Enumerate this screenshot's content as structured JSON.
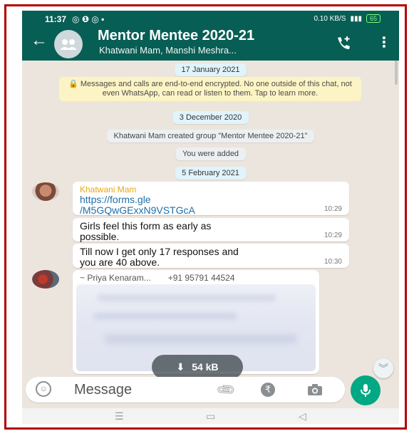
{
  "status_bar": {
    "time": "11:37",
    "net_speed": "0.10 KB/S",
    "battery": "65"
  },
  "header": {
    "title": "Mentor Mentee 2020-21",
    "subtitle": "Khatwani Mam, Manshi Meshra..."
  },
  "chat": {
    "date_1": "17 January 2021",
    "encryption_notice": "🔒 Messages and calls are end-to-end encrypted. No one outside of this chat, not even WhatsApp, can read or listen to them. Tap to learn more.",
    "date_2": "3 December 2020",
    "system_created": "Khatwani Mam created group \"Mentor Mentee 2020-21\"",
    "system_added": "You were added",
    "date_3": "5 February 2021",
    "messages": [
      {
        "sender": "Khatwani Mam",
        "text_line1": "https://forms.gle",
        "text_line2": "/M5GQwGExxN9VSTGcA",
        "time": "10:29"
      },
      {
        "text_line1": "Girls feel this form as early as",
        "text_line2": "possible.",
        "time": "10:29"
      },
      {
        "text_line1": "Till now I get only 17 responses and",
        "text_line2": "you are 40 above.",
        "time": "10:30"
      }
    ],
    "media": {
      "sender_name": "~ Priya Kenaram...",
      "sender_phone": "+91 95791 44524",
      "download_size": "54 kB"
    }
  },
  "input": {
    "placeholder": "Message"
  },
  "colors": {
    "header": "#075e54",
    "chat_bg": "#ece5dd",
    "sender_name": "#e6a817",
    "mic_button": "#00a884"
  },
  "icons": [
    "back-arrow-icon",
    "group-avatar-icon",
    "add-call-icon",
    "more-options-icon",
    "emoji-icon",
    "attach-icon",
    "rupee-payment-icon",
    "camera-icon",
    "mic-icon",
    "download-icon",
    "scroll-down-icon"
  ]
}
